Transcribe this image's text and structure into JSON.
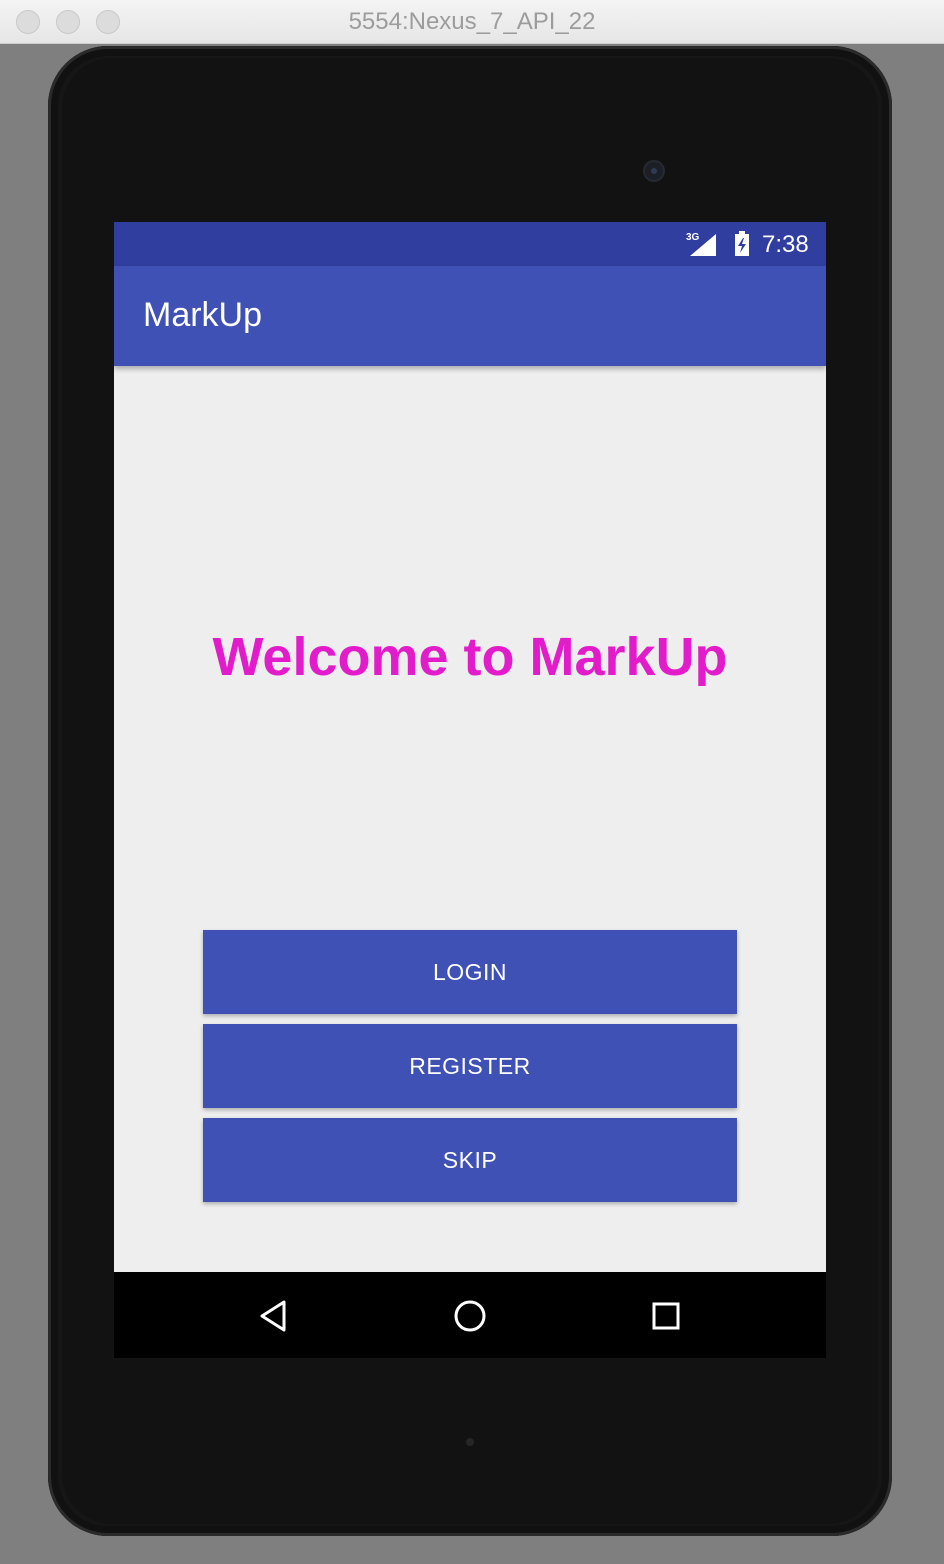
{
  "window": {
    "title": "5554:Nexus_7_API_22"
  },
  "status_bar": {
    "network": "3G",
    "time": "7:38",
    "icons": [
      "signal-icon",
      "battery-icon"
    ]
  },
  "app_bar": {
    "title": "MarkUp"
  },
  "main": {
    "welcome_text": "Welcome to MarkUp",
    "buttons": [
      {
        "label": "LOGIN"
      },
      {
        "label": "REGISTER"
      },
      {
        "label": "SKIP"
      }
    ]
  },
  "nav_bar": {
    "icons": [
      "back-icon",
      "home-icon",
      "recents-icon"
    ]
  },
  "colors": {
    "primary": "#3f51b5",
    "primary_dark": "#303f9f",
    "accent_text": "#e31ccb",
    "background": "#eeeeee"
  }
}
